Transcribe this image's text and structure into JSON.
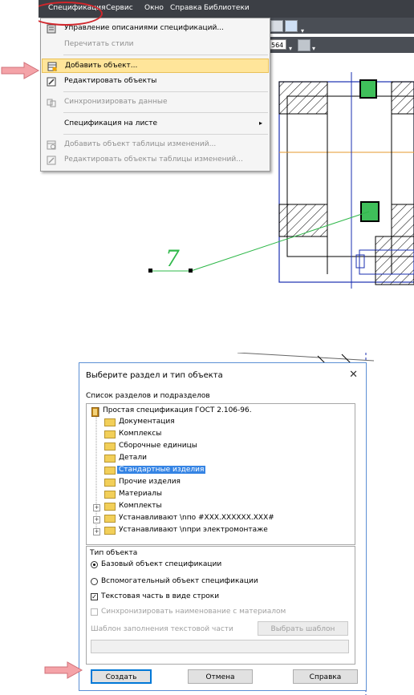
{
  "menubar": {
    "items": [
      "Спецификация",
      "Сервис",
      "Окно",
      "Справка",
      "Библиотеки"
    ],
    "toolbar_value": "564"
  },
  "dropdown": {
    "items": [
      {
        "label": "Управление описаниями спецификаций...",
        "enabled": true
      },
      {
        "label": "Перечитать стили",
        "enabled": false
      },
      {
        "label": "Добавить объект...",
        "enabled": true,
        "highlighted": true
      },
      {
        "label": "Редактировать объекты",
        "enabled": true
      },
      {
        "label": "Синхронизировать данные",
        "enabled": false
      },
      {
        "label": "Спецификация на листе",
        "enabled": true,
        "submenu": true
      },
      {
        "label": "Добавить объект таблицы изменений...",
        "enabled": false
      },
      {
        "label": "Редактировать объекты таблицы изменений...",
        "enabled": false
      }
    ]
  },
  "drawing": {
    "position_label": "7"
  },
  "dialog": {
    "title": "Выберите раздел и тип объекта",
    "close_label": "✕",
    "tree_label": "Список разделов и подразделов",
    "tree_root": "Простая спецификация ГОСТ 2.106-96.",
    "tree_items": [
      "Документация",
      "Комплексы",
      "Сборочные единицы",
      "Детали",
      "Стандартные изделия",
      "Прочие изделия",
      "Материалы",
      "Комплекты",
      "Устанавливают \\nпо #XXX.XXXXXX.XXX#",
      "Устанавливают \\nпри электромонтаже"
    ],
    "selected_item": "Стандартные изделия",
    "object_type_label": "Тип объекта",
    "radio_base": "Базовый объект спецификации",
    "radio_aux": "Вспомогательный объект спецификации",
    "check_text_part": "Текстовая часть в виде строки",
    "check_sync": "Синхронизировать наименование с материалом",
    "template_label": "Шаблон заполнения текстовой части",
    "choose_template_button": "Выбрать шаблон",
    "create_button": "Создать",
    "cancel_button": "Отмена",
    "help_button": "Справка"
  },
  "colors": {
    "menubar_bg": "#3c3f45",
    "highlight": "#ffe59a",
    "annotation_red": "#d0262b",
    "arrow_pink": "#f4a3a8",
    "selection_blue": "#3584e4"
  }
}
